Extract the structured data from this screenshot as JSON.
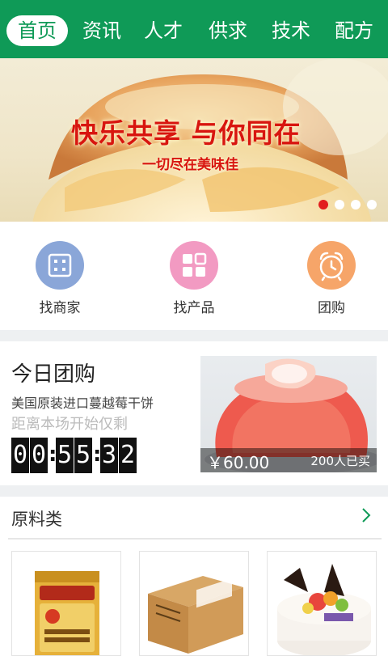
{
  "nav": {
    "tabs": [
      {
        "label": "首页",
        "active": true
      },
      {
        "label": "资讯"
      },
      {
        "label": "人才"
      },
      {
        "label": "供求"
      },
      {
        "label": "技术"
      },
      {
        "label": "配方"
      }
    ]
  },
  "banner": {
    "title": "快乐共享 与你同在",
    "subtitle": "一切尽在美味佳",
    "active_slide": 1,
    "slide_count": 4
  },
  "quick": {
    "items": [
      {
        "label": "找商家",
        "icon": "store-grid-icon",
        "color": "#8aa6d8"
      },
      {
        "label": "找产品",
        "icon": "product-tiles-icon",
        "color": "#f29ac2"
      },
      {
        "label": "团购",
        "icon": "alarm-clock-icon",
        "color": "#f6a569"
      }
    ]
  },
  "group_buy": {
    "title": "今日团购",
    "product": "美国原装进口蔓越莓干饼",
    "remaining_label": "距离本场开始仅剩",
    "timer": [
      "0",
      "0",
      ":",
      "5",
      "5",
      ":",
      "3",
      "2"
    ],
    "price": "￥60.00",
    "sold": "200人已买"
  },
  "category": {
    "title": "原料类",
    "more_icon": "chevron-right-icon",
    "products": [
      {
        "image": "butter-tin-image"
      },
      {
        "image": "cardboard-box-image"
      },
      {
        "image": "fruit-cake-image"
      }
    ]
  },
  "colors": {
    "brand": "#0f9a57",
    "banner_text": "#d8150f",
    "dot_active": "#e21e1e"
  }
}
